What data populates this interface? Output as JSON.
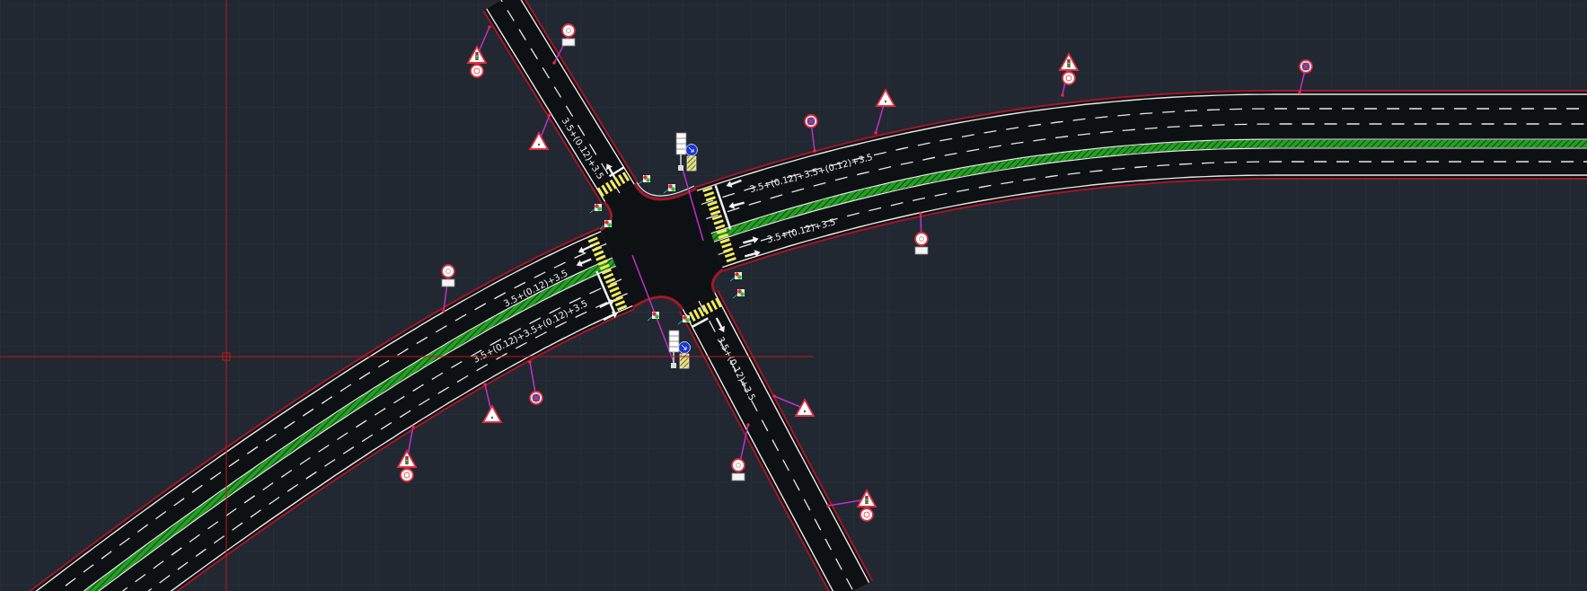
{
  "drawing": {
    "lane_labels": [
      {
        "text": "3.5+(0.12)+3.5"
      },
      {
        "text": "3.5+(0.12)+3.5+(0.12)+3.5"
      },
      {
        "text": "3.5+(0.12)+3.5"
      },
      {
        "text": "3.5+(0.12)+3.5"
      },
      {
        "text": "3.5+(0.12)+3.5+(0.12)+3.5"
      },
      {
        "text": "3.5+(0.12)+3.5"
      }
    ]
  }
}
